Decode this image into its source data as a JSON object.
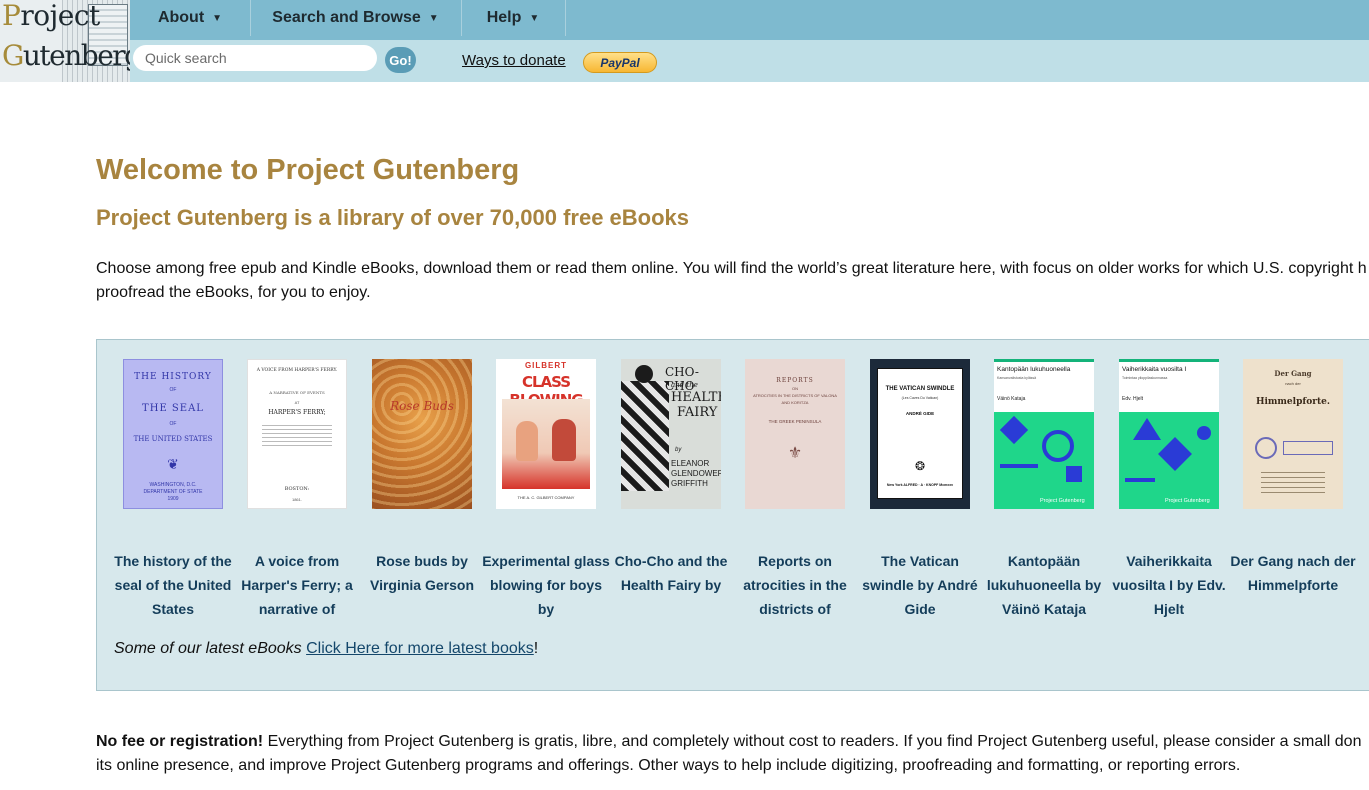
{
  "header": {
    "logo": {
      "line1_cap": "P",
      "line1_rest": "roject",
      "line2_cap": "G",
      "line2_rest": "utenberg"
    },
    "menu": [
      {
        "label": "About",
        "icon": "caret-down-icon"
      },
      {
        "label": "Search and Browse",
        "icon": "caret-down-icon"
      },
      {
        "label": "Help",
        "icon": "caret-down-icon"
      }
    ],
    "search_placeholder": "Quick search",
    "go_label": "Go!",
    "donate_label": "Ways to donate",
    "paypal_label": "PayPal"
  },
  "main": {
    "title": "Welcome to Project Gutenberg",
    "subtitle": "Project Gutenberg is a library of over 70,000 free eBooks",
    "intro_line1": "Choose among free epub and Kindle eBooks, download them or read them online. You will find the world’s great literature here, with focus on older works for which U.S. copyright h",
    "intro_line2": "proofread the eBooks, for you to enjoy.",
    "latest": {
      "books": [
        {
          "title": "The history of the seal of the United States"
        },
        {
          "title": "A voice from Harper's Ferry; a narrative of"
        },
        {
          "title": "Rose buds by Virginia Gerson"
        },
        {
          "title": "Experimental glass blowing for boys by"
        },
        {
          "title": "Cho-Cho and the Health Fairy by"
        },
        {
          "title": "Reports on atrocities in the districts of"
        },
        {
          "title": "The Vatican swindle by André Gide"
        },
        {
          "title": "Kantopään lukuhuoneella by Väinö Kataja"
        },
        {
          "title": "Vaiherikkaita vuosilta I by Edv. Hjelt"
        },
        {
          "title": "Der Gang nach der Himmelpforte"
        }
      ],
      "covers": {
        "c1": {
          "l1": "THE HISTORY",
          "l2": "OF",
          "l3": "THE SEAL",
          "l4": "OF",
          "l5": "THE UNITED STATES",
          "l6": "WASHINGTON, D.C.",
          "l7": "DEPARTMENT OF STATE",
          "l8": "1909"
        },
        "c2": {
          "l1": "A VOICE FROM HARPER'S FERRY.",
          "l2": "A NARRATIVE OF EVENTS",
          "l3": "AT",
          "l4": "HARPER'S FERRY;",
          "l5": "BOSTON:",
          "l6": "1861."
        },
        "c3": {
          "l1": "Rose Buds"
        },
        "c4": {
          "l1": "GILBERT",
          "l2": "CLASS BLOWING",
          "l3": "THE A. C. GILBERT COMPANY"
        },
        "c5": {
          "l1": "CHO-CHO",
          "l2": "and the",
          "l3": "HEALTH",
          "l4": "FAIRY",
          "l5": "by",
          "l6": "ELEANOR",
          "l7": "GLENDOWER",
          "l8": "GRIFFITH"
        },
        "c6": {
          "l1": "REPORTS",
          "l2": "ON",
          "l3": "ATROCITIES IN THE DISTRICTS OF VALONA",
          "l4": "AND KORITZA",
          "l5": "THE GREEK PENINSULA"
        },
        "c7": {
          "l1": "THE VATICAN SWINDLE",
          "l2": "(Les Caves Du Vatican)",
          "l3": "ANDRÉ GIDE",
          "l4": "New York  ALFRED · A · KNOPF  Mcmxxv"
        },
        "c8": {
          "l1": "Kantopään lukuhuoneella",
          "l2": "Kansanvalistusta kylässä",
          "l3": "Väinö Kataja",
          "l4": "Project Gutenberg"
        },
        "c9": {
          "l1": "Vaiherikkaita vuosilta I",
          "l2": "Toimintaa ylioppilaskunnassa",
          "l3": "Edv. Hjelt",
          "l4": "Project Gutenberg"
        },
        "c10": {
          "l1": "Der Gang",
          "l2": "nach der",
          "l3": "Himmelpforte."
        }
      },
      "footer_label": "Some of our latest eBooks",
      "footer_link": "Click Here for more latest books",
      "footer_end": "!"
    },
    "nofee_bold": "No fee or registration!",
    "nofee_line1": " Everything from Project Gutenberg is gratis, libre, and completely without cost to readers. If you find Project Gutenberg useful, please consider a small don",
    "nofee_line2": "its online presence, and improve Project Gutenberg programs and offerings. Other ways to help include digitizing, proofreading and formatting, or reporting errors."
  },
  "colors": {
    "topbar": "#7ebacf",
    "subbar": "#bfdfe7",
    "heading": "#a8843f",
    "panel": "#d7e8ec",
    "book_title": "#143d5a"
  }
}
